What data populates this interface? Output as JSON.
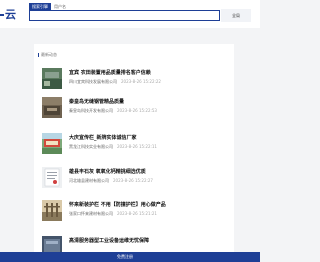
{
  "header": {
    "logo_text": "云",
    "search_tabs": [
      "搜索引擎",
      "用户名"
    ],
    "search_button_label": "全局"
  },
  "section": {
    "title": "最新动态"
  },
  "items": [
    {
      "title": "宜宾 农田装置用品质量排名客户信赖",
      "company": "四川宜宾科技发展有限公司",
      "date": "2023-8-26 15:22:22"
    },
    {
      "title": "秦皇岛无缝钢管精品质量",
      "company": "秦皇岛科技开发有限公司",
      "date": "2023-8-26 15:22:53"
    },
    {
      "title": "大庆宣传栏_新牌实体诚信厂家",
      "company": "黑龙江科技实业有限公司",
      "date": "2023-8-26 15:22:11"
    },
    {
      "title": "雄县丰石灰 氧氧化钙精挑细选优质",
      "company": "河北雄县建材有限公司",
      "date": "2023-8-26 15:22:27"
    },
    {
      "title": "怀来新装护栏 不用【防撞护栏】用心做产品",
      "company": "张家口怀来建材有限公司",
      "date": "2023-8-26 15:21:21"
    },
    {
      "title": "高清服务器型工业设备运维无忧保障",
      "company": "",
      "date": ""
    }
  ],
  "footer": {
    "label": "免费注册"
  }
}
